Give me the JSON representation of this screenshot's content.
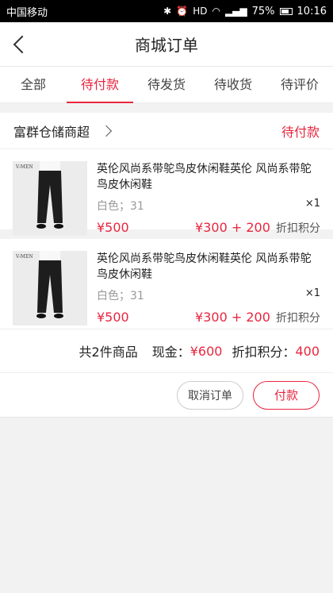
{
  "status_bar": {
    "carrier": "中国移动",
    "icons": [
      "bluetooth-icon",
      "alarm-icon",
      "hd-icon",
      "wifi-icon",
      "signal-icon"
    ],
    "battery": "75%",
    "time": "10:16"
  },
  "nav": {
    "title": "商城订单"
  },
  "tabs": [
    {
      "label": "全部",
      "active": false
    },
    {
      "label": "待付款",
      "active": true
    },
    {
      "label": "待发货",
      "active": false
    },
    {
      "label": "待收货",
      "active": false
    },
    {
      "label": "待评价",
      "active": false
    }
  ],
  "shop": {
    "name": "富群仓储商超",
    "status": "待付款"
  },
  "items": [
    {
      "name": "英伦风尚系带鸵鸟皮休闲鞋英伦 风尚系带鸵鸟皮休闲鞋",
      "spec": "白色；31",
      "qty": "×1",
      "price": "¥500",
      "cash": "¥300",
      "plus": "+",
      "points": "200",
      "points_unit": "折扣积分",
      "thumb_brand": "V-MEN"
    },
    {
      "name": "英伦风尚系带鸵鸟皮休闲鞋英伦 风尚系带鸵鸟皮休闲鞋",
      "spec": "白色；31",
      "qty": "×1",
      "price": "¥500",
      "cash": "¥300",
      "plus": "+",
      "points": "200",
      "points_unit": "折扣积分",
      "thumb_brand": "V-MEN"
    }
  ],
  "summary": {
    "count_text": "共2件商品",
    "cash_label": "现金：",
    "cash_value": "¥600",
    "points_label": "折扣积分：",
    "points_value": "400"
  },
  "actions": {
    "cancel": "取消订单",
    "pay": "付款"
  },
  "colors": {
    "accent": "#e8263f",
    "background": "#f2f2f2"
  }
}
